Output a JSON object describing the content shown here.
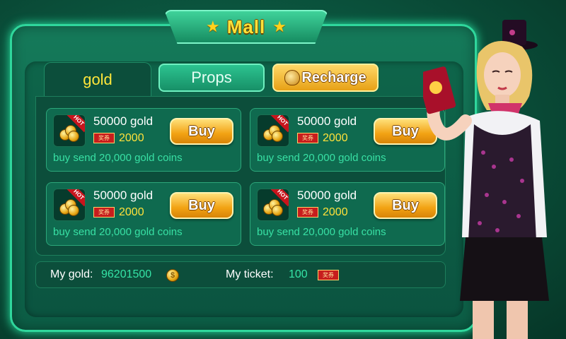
{
  "title": "Mall",
  "tabs": {
    "gold": "gold",
    "props": "Props",
    "recharge": "Recharge"
  },
  "items": [
    {
      "name": "50000 gold",
      "hot": "HOT",
      "ticket_label": "奖券",
      "ticket": "2000",
      "desc": "buy send 20,000 gold coins",
      "button": "Buy"
    },
    {
      "name": "50000 gold",
      "hot": "HOT",
      "ticket_label": "奖券",
      "ticket": "2000",
      "desc": "buy send 20,000 gold coins",
      "button": "Buy"
    },
    {
      "name": "50000 gold",
      "hot": "HOT",
      "ticket_label": "奖券",
      "ticket": "2000",
      "desc": "buy send 20,000 gold coins",
      "button": "Buy"
    },
    {
      "name": "50000 gold",
      "hot": "HOT",
      "ticket_label": "奖券",
      "ticket": "2000",
      "desc": "buy send 20,000 gold coins",
      "button": "Buy"
    }
  ],
  "footer": {
    "gold_label": "My gold:",
    "gold_value": "96201500",
    "gold_icon": "$",
    "ticket_label": "My ticket:",
    "ticket_value": "100",
    "ticket_icon_label": "奖券"
  },
  "colors": {
    "accent_green": "#35e4a6",
    "gold_yellow": "#ffe13a",
    "button_orange": "#f2a213"
  }
}
